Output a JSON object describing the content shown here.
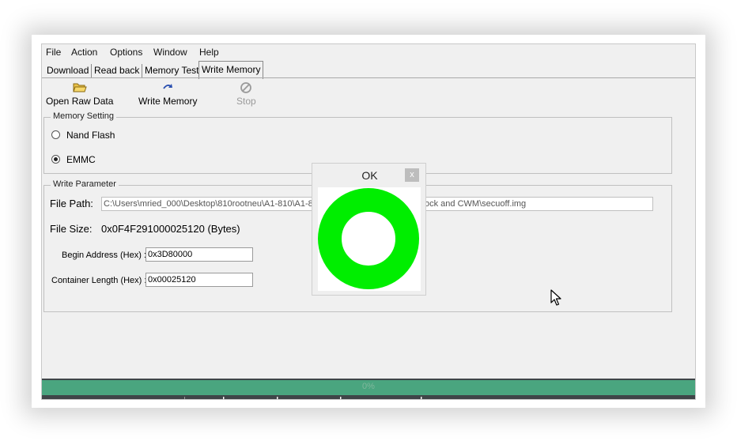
{
  "menu": [
    "File",
    "Action",
    "Options",
    "Window",
    "Help"
  ],
  "tabs": [
    "Download",
    "Read back",
    "Memory Test",
    "Write Memory"
  ],
  "toolbar": {
    "open_raw_data": "Open Raw Data",
    "write_memory": "Write Memory",
    "stop": "Stop"
  },
  "memory_setting": {
    "legend": "Memory Setting",
    "nand_flash": "Nand Flash",
    "emmc": "EMMC",
    "selected": "EMMC"
  },
  "write_parameter": {
    "legend": "Write Parameter",
    "file_path_label": "File Path:",
    "file_path_value": "C:\\Users\\mried_000\\Desktop\\810rootneu\\A1-810\\A1-8",
    "file_path_tail": "ock and CWM\\secuoff.img",
    "file_size_label": "File Size:",
    "file_size_value": "0x0F4F291000025120  (Bytes)",
    "begin_address_label": "Begin Address (Hex) :",
    "begin_address_value": "0x3D80000",
    "container_length_label": "Container Length (Hex) :",
    "container_length_value": "0x00025120"
  },
  "progress": {
    "text": "0%",
    "fraction": 1.0
  },
  "popup": {
    "title": "OK",
    "close": "x"
  },
  "colors": {
    "progress": "#4aa57f",
    "ring": "#00ee00"
  },
  "icons": [
    "open-folder-icon",
    "write-memory-icon",
    "stop-icon",
    "mouse-cursor-icon"
  ]
}
